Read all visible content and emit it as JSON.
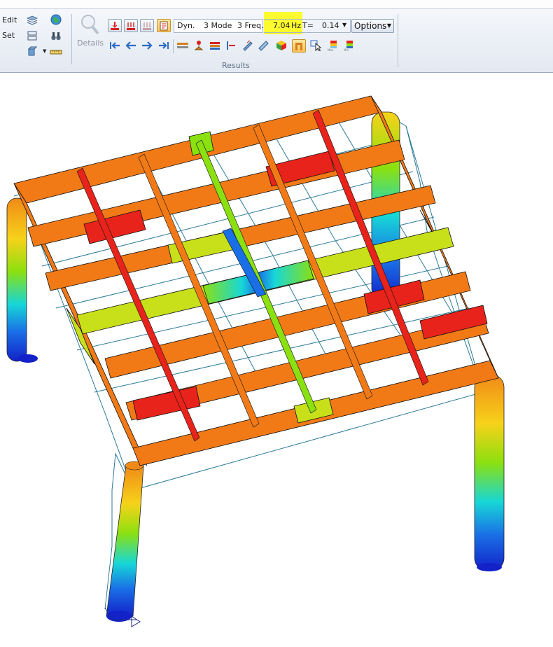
{
  "ribbon": {
    "edit_label": "Edit",
    "set_label": "Set",
    "details_label": "Details",
    "dyn_label": "Dyn.",
    "mode_value": "3",
    "mode_label": "Mode",
    "freq_value": "3",
    "freq_label": "Freq.=",
    "frequency_value": "7.04",
    "frequency_unit": "Hz",
    "t_label": "T=",
    "t_value": "0.14",
    "options_label": "Options",
    "group_label": "Results",
    "highlight_color": "#fbfb2f"
  },
  "icons": {
    "row1": [
      "deformation-icon",
      "multi-deformation-icon",
      "grid-deformation-icon",
      "animation-icon"
    ],
    "row2": [
      "first-icon",
      "previous-icon",
      "next-icon",
      "last-icon",
      "section-icon",
      "support-icon",
      "layers-icon",
      "member-icon",
      "beam-icon",
      "surface-icon",
      "cube-color-icon",
      "active-frame-icon",
      "select-icon",
      "max-scale-icon",
      "min-scale-icon"
    ],
    "left": [
      "layers-stack-icon",
      "globe-icon",
      "view-icon",
      "binoculars-icon",
      "box-icon",
      "ruler-icon"
    ]
  },
  "colors": {
    "max": "#e8231b",
    "mid": "#8be010",
    "min": "#1032d8"
  }
}
